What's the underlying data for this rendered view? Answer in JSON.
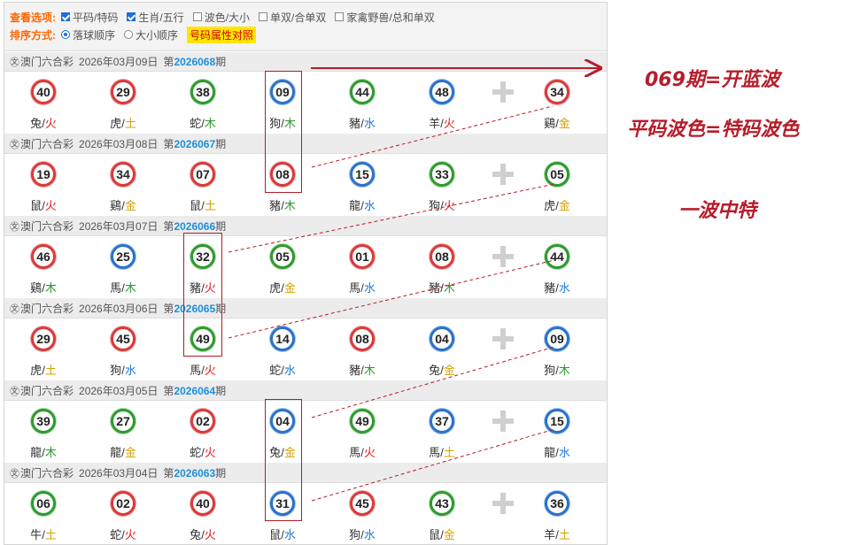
{
  "options": {
    "view_label": "查看选项:",
    "view": [
      {
        "label": "平码/特码",
        "checked": true
      },
      {
        "label": "生肖/五行",
        "checked": true
      },
      {
        "label": "波色/大小",
        "checked": false
      },
      {
        "label": "单双/合单双",
        "checked": false
      },
      {
        "label": "家禽野兽/总和单双",
        "checked": false
      }
    ],
    "sort_label": "排序方式:",
    "sort": [
      {
        "label": "落球顺序",
        "checked": true
      },
      {
        "label": "大小顺序",
        "checked": false
      }
    ],
    "attr_button": "号码属性对照"
  },
  "periods": [
    {
      "logo": "㉆",
      "lottery": "澳门六合彩",
      "date": "2026年03月09日",
      "prefix": "第",
      "number": "2026068",
      "suffix": "期",
      "balls": [
        {
          "n": "40",
          "c": "red",
          "z": "兔",
          "e": "火"
        },
        {
          "n": "29",
          "c": "red",
          "z": "虎",
          "e": "土"
        },
        {
          "n": "38",
          "c": "green",
          "z": "蛇",
          "e": "木"
        },
        {
          "n": "09",
          "c": "blue",
          "z": "狗",
          "e": "木"
        },
        {
          "n": "44",
          "c": "green",
          "z": "豬",
          "e": "水"
        },
        {
          "n": "48",
          "c": "blue",
          "z": "羊",
          "e": "火"
        },
        {
          "n": "34",
          "c": "red",
          "z": "鷄",
          "e": "金"
        }
      ]
    },
    {
      "logo": "㉆",
      "lottery": "澳门六合彩",
      "date": "2026年03月08日",
      "prefix": "第",
      "number": "2026067",
      "suffix": "期",
      "balls": [
        {
          "n": "19",
          "c": "red",
          "z": "鼠",
          "e": "火"
        },
        {
          "n": "34",
          "c": "red",
          "z": "鷄",
          "e": "金"
        },
        {
          "n": "07",
          "c": "red",
          "z": "鼠",
          "e": "土"
        },
        {
          "n": "08",
          "c": "red",
          "z": "豬",
          "e": "木"
        },
        {
          "n": "15",
          "c": "blue",
          "z": "龍",
          "e": "水"
        },
        {
          "n": "33",
          "c": "green",
          "z": "狗",
          "e": "火"
        },
        {
          "n": "05",
          "c": "green",
          "z": "虎",
          "e": "金"
        }
      ]
    },
    {
      "logo": "㉆",
      "lottery": "澳门六合彩",
      "date": "2026年03月07日",
      "prefix": "第",
      "number": "2026066",
      "suffix": "期",
      "balls": [
        {
          "n": "46",
          "c": "red",
          "z": "鷄",
          "e": "木"
        },
        {
          "n": "25",
          "c": "blue",
          "z": "馬",
          "e": "木"
        },
        {
          "n": "32",
          "c": "green",
          "z": "豬",
          "e": "火"
        },
        {
          "n": "05",
          "c": "green",
          "z": "虎",
          "e": "金"
        },
        {
          "n": "01",
          "c": "red",
          "z": "馬",
          "e": "水"
        },
        {
          "n": "08",
          "c": "red",
          "z": "豬",
          "e": "木"
        },
        {
          "n": "44",
          "c": "green",
          "z": "豬",
          "e": "水"
        }
      ]
    },
    {
      "logo": "㉆",
      "lottery": "澳门六合彩",
      "date": "2026年03月06日",
      "prefix": "第",
      "number": "2026065",
      "suffix": "期",
      "balls": [
        {
          "n": "29",
          "c": "red",
          "z": "虎",
          "e": "土"
        },
        {
          "n": "45",
          "c": "red",
          "z": "狗",
          "e": "水"
        },
        {
          "n": "49",
          "c": "green",
          "z": "馬",
          "e": "火"
        },
        {
          "n": "14",
          "c": "blue",
          "z": "蛇",
          "e": "水"
        },
        {
          "n": "08",
          "c": "red",
          "z": "豬",
          "e": "木"
        },
        {
          "n": "04",
          "c": "blue",
          "z": "兔",
          "e": "金"
        },
        {
          "n": "09",
          "c": "blue",
          "z": "狗",
          "e": "木"
        }
      ]
    },
    {
      "logo": "㉆",
      "lottery": "澳门六合彩",
      "date": "2026年03月05日",
      "prefix": "第",
      "number": "2026064",
      "suffix": "期",
      "balls": [
        {
          "n": "39",
          "c": "green",
          "z": "龍",
          "e": "木"
        },
        {
          "n": "27",
          "c": "green",
          "z": "龍",
          "e": "金"
        },
        {
          "n": "02",
          "c": "red",
          "z": "蛇",
          "e": "火"
        },
        {
          "n": "04",
          "c": "blue",
          "z": "兔",
          "e": "金"
        },
        {
          "n": "49",
          "c": "green",
          "z": "馬",
          "e": "火"
        },
        {
          "n": "37",
          "c": "blue",
          "z": "馬",
          "e": "土"
        },
        {
          "n": "15",
          "c": "blue",
          "z": "龍",
          "e": "水"
        }
      ]
    },
    {
      "logo": "㉆",
      "lottery": "澳门六合彩",
      "date": "2026年03月04日",
      "prefix": "第",
      "number": "2026063",
      "suffix": "期",
      "balls": [
        {
          "n": "06",
          "c": "green",
          "z": "牛",
          "e": "土"
        },
        {
          "n": "02",
          "c": "red",
          "z": "蛇",
          "e": "火"
        },
        {
          "n": "40",
          "c": "red",
          "z": "兔",
          "e": "火"
        },
        {
          "n": "31",
          "c": "blue",
          "z": "鼠",
          "e": "水"
        },
        {
          "n": "45",
          "c": "red",
          "z": "狗",
          "e": "水"
        },
        {
          "n": "43",
          "c": "green",
          "z": "鼠",
          "e": "金"
        },
        {
          "n": "36",
          "c": "blue",
          "z": "羊",
          "e": "土"
        }
      ]
    }
  ],
  "element_colors": {
    "火": "el-red",
    "木": "el-green",
    "水": "el-blue",
    "金": "el-gold",
    "土": "el-gold"
  },
  "annotations": {
    "note1": "069期=开蓝波",
    "note2": "平码波色=特码波色",
    "note3": "一波中特"
  }
}
